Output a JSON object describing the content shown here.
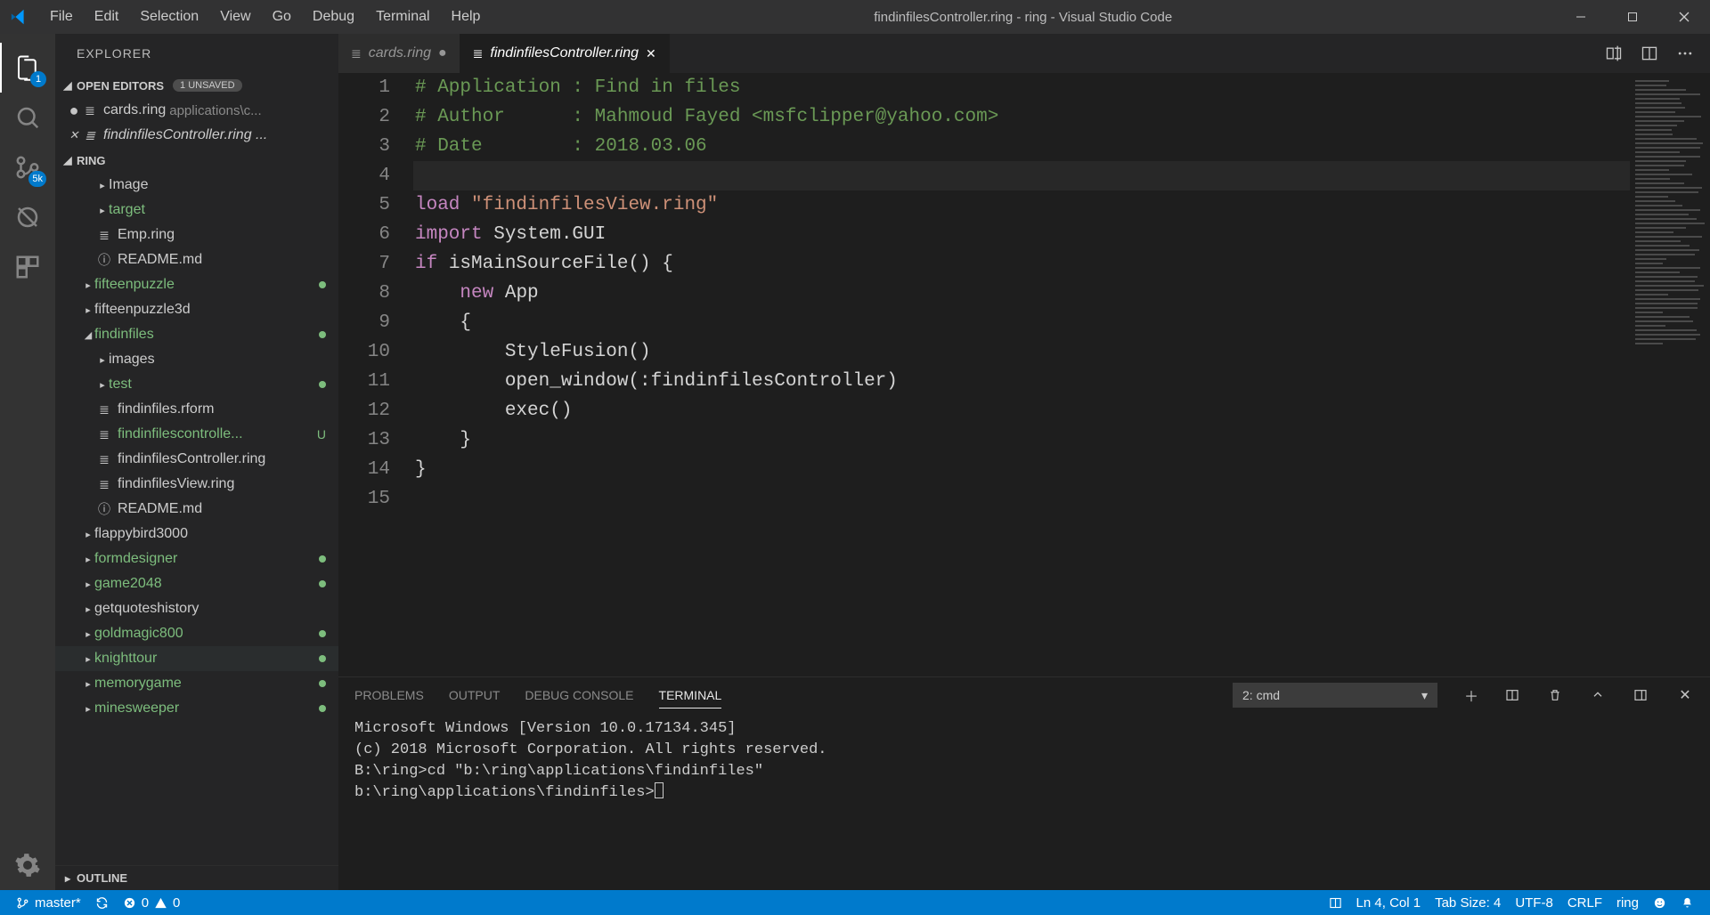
{
  "window": {
    "title": "findinfilesController.ring - ring - Visual Studio Code"
  },
  "menu": {
    "items": [
      "File",
      "Edit",
      "Selection",
      "View",
      "Go",
      "Debug",
      "Terminal",
      "Help"
    ]
  },
  "activitybar": {
    "explorer_badge": "1",
    "scm_badge": "5k"
  },
  "sidebar": {
    "title": "EXPLORER",
    "open_editors_label": "OPEN EDITORS",
    "unsaved_badge": "1 UNSAVED",
    "open_editors": [
      {
        "name": "cards.ring",
        "path": "applications\\c...",
        "dirty": true
      },
      {
        "name": "findinfilesController.ring ...",
        "path": "",
        "close": true
      }
    ],
    "workspace_label": "RING",
    "tree": [
      {
        "type": "folder",
        "name": "Image",
        "depth": 2,
        "collapsed": true,
        "green": false
      },
      {
        "type": "folder",
        "name": "target",
        "depth": 2,
        "collapsed": true,
        "green": true
      },
      {
        "type": "file",
        "name": "Emp.ring",
        "depth": 2,
        "icon": "≣"
      },
      {
        "type": "file",
        "name": "README.md",
        "depth": 2,
        "icon": "ⓘ"
      },
      {
        "type": "folder",
        "name": "fifteenpuzzle",
        "depth": 1,
        "collapsed": true,
        "green": true,
        "dot": true
      },
      {
        "type": "folder",
        "name": "fifteenpuzzle3d",
        "depth": 1,
        "collapsed": true,
        "green": false
      },
      {
        "type": "folder",
        "name": "findinfiles",
        "depth": 1,
        "collapsed": false,
        "green": true,
        "dot": true
      },
      {
        "type": "folder",
        "name": "images",
        "depth": 2,
        "collapsed": true,
        "green": false
      },
      {
        "type": "folder",
        "name": "test",
        "depth": 2,
        "collapsed": true,
        "green": true,
        "dot": true
      },
      {
        "type": "file",
        "name": "findinfiles.rform",
        "depth": 2,
        "icon": "≣"
      },
      {
        "type": "file",
        "name": "findinfilescontrolle...",
        "depth": 2,
        "icon": "≣",
        "green": true,
        "u": true
      },
      {
        "type": "file",
        "name": "findinfilesController.ring",
        "depth": 2,
        "icon": "≣"
      },
      {
        "type": "file",
        "name": "findinfilesView.ring",
        "depth": 2,
        "icon": "≣"
      },
      {
        "type": "file",
        "name": "README.md",
        "depth": 2,
        "icon": "ⓘ"
      },
      {
        "type": "folder",
        "name": "flappybird3000",
        "depth": 1,
        "collapsed": true,
        "green": false
      },
      {
        "type": "folder",
        "name": "formdesigner",
        "depth": 1,
        "collapsed": true,
        "green": true,
        "dot": true
      },
      {
        "type": "folder",
        "name": "game2048",
        "depth": 1,
        "collapsed": true,
        "green": true,
        "dot": true
      },
      {
        "type": "folder",
        "name": "getquoteshistory",
        "depth": 1,
        "collapsed": true,
        "green": false
      },
      {
        "type": "folder",
        "name": "goldmagic800",
        "depth": 1,
        "collapsed": true,
        "green": true,
        "dot": true
      },
      {
        "type": "folder",
        "name": "knighttour",
        "depth": 1,
        "collapsed": true,
        "green": true,
        "dot": true,
        "hover": true
      },
      {
        "type": "folder",
        "name": "memorygame",
        "depth": 1,
        "collapsed": true,
        "green": true,
        "dot": true
      },
      {
        "type": "folder",
        "name": "minesweeper",
        "depth": 1,
        "collapsed": true,
        "green": true,
        "dot": true
      }
    ],
    "outline_label": "OUTLINE"
  },
  "tabs": [
    {
      "name": "cards.ring",
      "dirty": true,
      "active": false
    },
    {
      "name": "findinfilesController.ring",
      "dirty": false,
      "active": true
    }
  ],
  "editor": {
    "lines": [
      {
        "n": "1",
        "spans": [
          {
            "t": "# Application : Find in files",
            "c": "c-comment"
          }
        ]
      },
      {
        "n": "2",
        "spans": [
          {
            "t": "# Author      : Mahmoud Fayed <msfclipper@yahoo.com>",
            "c": "c-comment"
          }
        ]
      },
      {
        "n": "3",
        "spans": [
          {
            "t": "# Date        : 2018.03.06",
            "c": "c-comment"
          }
        ]
      },
      {
        "n": "4",
        "spans": [],
        "current": true
      },
      {
        "n": "5",
        "spans": [
          {
            "t": "load ",
            "c": "c-keyword"
          },
          {
            "t": "\"findinfilesView.ring\"",
            "c": "c-string"
          }
        ]
      },
      {
        "n": "6",
        "spans": [
          {
            "t": "import ",
            "c": "c-keyword"
          },
          {
            "t": "System.GUI",
            "c": "c-func"
          }
        ]
      },
      {
        "n": "7",
        "spans": [
          {
            "t": "if ",
            "c": "c-keyword"
          },
          {
            "t": "isMainSourceFile() {",
            "c": "c-func"
          }
        ]
      },
      {
        "n": "8",
        "spans": [
          {
            "t": "    ",
            "c": ""
          },
          {
            "t": "new ",
            "c": "c-keyword"
          },
          {
            "t": "App",
            "c": "c-func"
          }
        ]
      },
      {
        "n": "9",
        "spans": [
          {
            "t": "    {",
            "c": "c-func"
          }
        ]
      },
      {
        "n": "10",
        "spans": [
          {
            "t": "        StyleFusion()",
            "c": "c-func"
          }
        ]
      },
      {
        "n": "11",
        "spans": [
          {
            "t": "        open_window(:findinfilesController)",
            "c": "c-func"
          }
        ]
      },
      {
        "n": "12",
        "spans": [
          {
            "t": "        exec()",
            "c": "c-func"
          }
        ]
      },
      {
        "n": "13",
        "spans": [
          {
            "t": "    }",
            "c": "c-func"
          }
        ]
      },
      {
        "n": "14",
        "spans": [
          {
            "t": "}",
            "c": "c-func"
          }
        ]
      },
      {
        "n": "15",
        "spans": []
      }
    ]
  },
  "panel": {
    "tabs": {
      "problems": "PROBLEMS",
      "output": "OUTPUT",
      "debug": "DEBUG CONSOLE",
      "terminal": "TERMINAL"
    },
    "terminal_selector": "2: cmd",
    "terminal_lines": [
      "Microsoft Windows [Version 10.0.17134.345]",
      "(c) 2018 Microsoft Corporation. All rights reserved.",
      "",
      "B:\\ring>cd \"b:\\ring\\applications\\findinfiles\"",
      "",
      "b:\\ring\\applications\\findinfiles>"
    ]
  },
  "statusbar": {
    "branch": "master*",
    "errors": "0",
    "warnings": "0",
    "line_col": "Ln 4, Col 1",
    "tab_size": "Tab Size: 4",
    "encoding": "UTF-8",
    "eol": "CRLF",
    "lang": "ring"
  }
}
